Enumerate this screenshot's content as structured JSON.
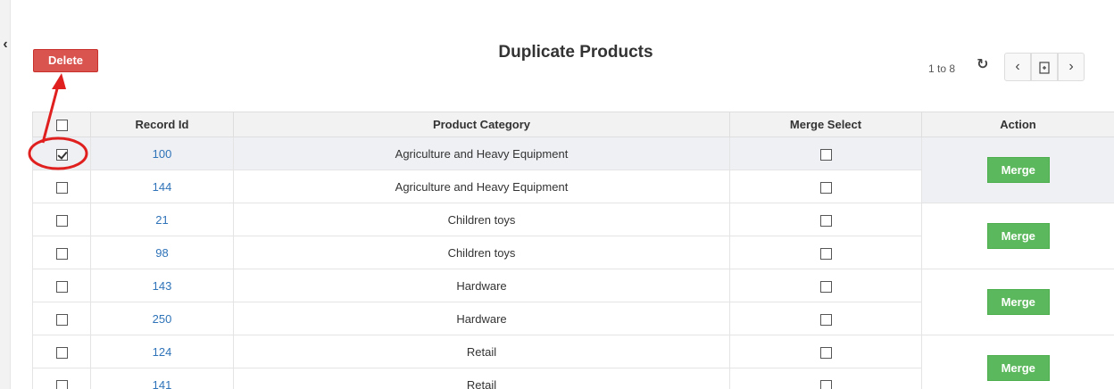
{
  "header": {
    "title": "Duplicate Products",
    "delete_label": "Delete",
    "range_text": "1 to 8"
  },
  "table": {
    "columns": [
      "Record Id",
      "Product Category",
      "Merge Select",
      "Action"
    ],
    "merge_label": "Merge",
    "rows": [
      {
        "id": "100",
        "category": "Agriculture and Heavy Equipment",
        "checked": true
      },
      {
        "id": "144",
        "category": "Agriculture and Heavy Equipment",
        "checked": false
      },
      {
        "id": "21",
        "category": "Children toys",
        "checked": false
      },
      {
        "id": "98",
        "category": "Children toys",
        "checked": false
      },
      {
        "id": "143",
        "category": "Hardware",
        "checked": false
      },
      {
        "id": "250",
        "category": "Hardware",
        "checked": false
      },
      {
        "id": "124",
        "category": "Retail",
        "checked": false
      },
      {
        "id": "141",
        "category": "Retail",
        "checked": false
      }
    ]
  },
  "colors": {
    "delete": "#d9534f",
    "merge": "#5cb85c",
    "annotation": "#e0201f",
    "link": "#2f73b8"
  },
  "icons": {
    "collapse": "chevron-left-icon",
    "refresh": "refresh-icon",
    "prev": "chevron-left-icon",
    "export": "export-icon",
    "next": "chevron-right-icon"
  }
}
